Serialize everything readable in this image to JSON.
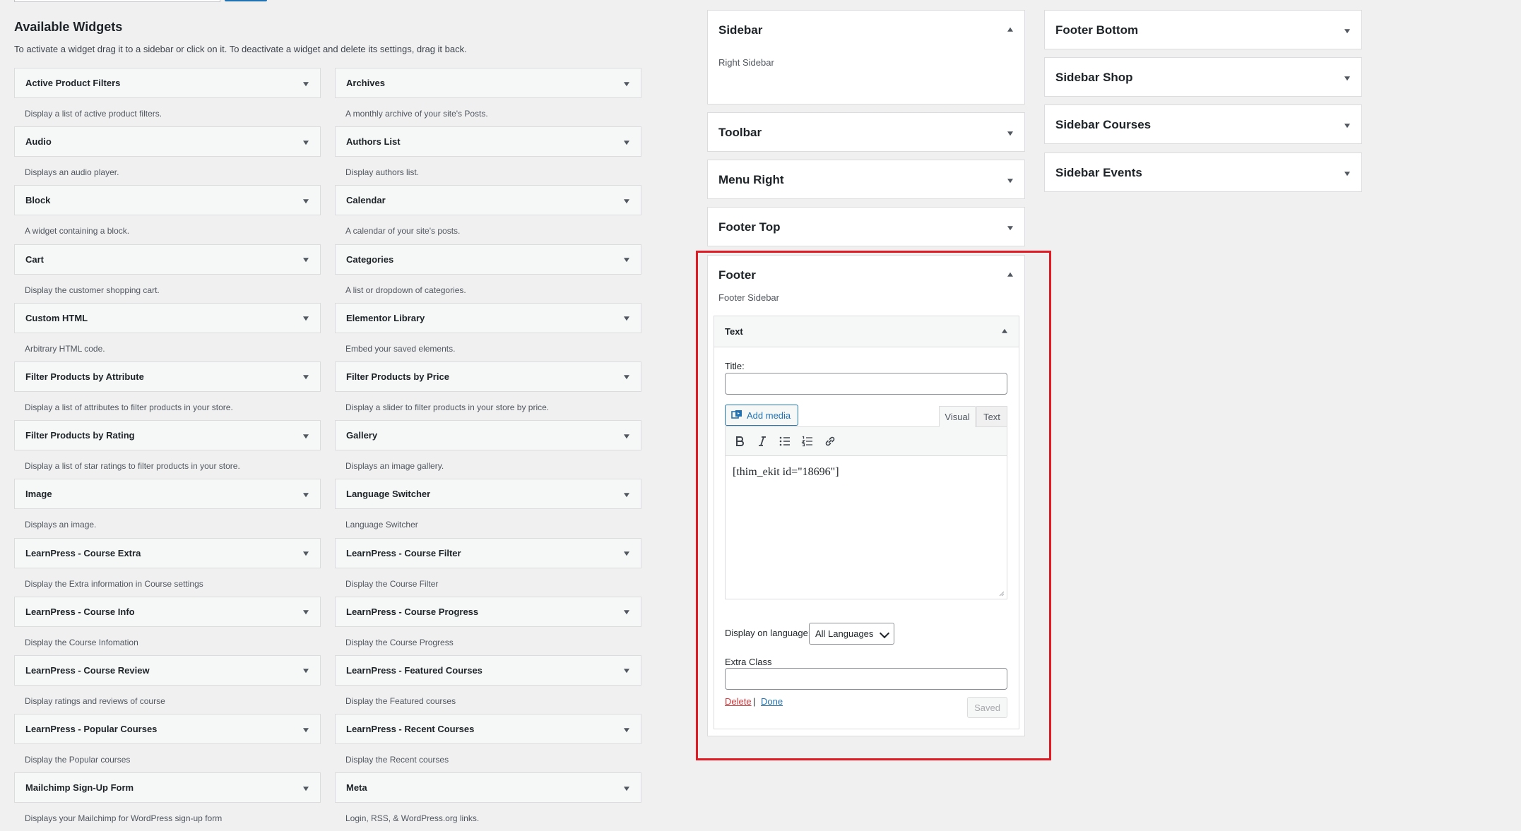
{
  "available_widgets": {
    "title": "Available Widgets",
    "description": "To activate a widget drag it to a sidebar or click on it. To deactivate a widget and delete its settings, drag it back.",
    "items": [
      {
        "name": "Active Product Filters",
        "desc": "Display a list of active product filters."
      },
      {
        "name": "Archives",
        "desc": "A monthly archive of your site's Posts."
      },
      {
        "name": "Audio",
        "desc": "Displays an audio player."
      },
      {
        "name": "Authors List",
        "desc": "Display authors list."
      },
      {
        "name": "Block",
        "desc": "A widget containing a block."
      },
      {
        "name": "Calendar",
        "desc": "A calendar of your site's posts."
      },
      {
        "name": "Cart",
        "desc": "Display the customer shopping cart."
      },
      {
        "name": "Categories",
        "desc": "A list or dropdown of categories."
      },
      {
        "name": "Custom HTML",
        "desc": "Arbitrary HTML code."
      },
      {
        "name": "Elementor Library",
        "desc": "Embed your saved elements."
      },
      {
        "name": "Filter Products by Attribute",
        "desc": "Display a list of attributes to filter products in your store."
      },
      {
        "name": "Filter Products by Price",
        "desc": "Display a slider to filter products in your store by price."
      },
      {
        "name": "Filter Products by Rating",
        "desc": "Display a list of star ratings to filter products in your store."
      },
      {
        "name": "Gallery",
        "desc": "Displays an image gallery."
      },
      {
        "name": "Image",
        "desc": "Displays an image."
      },
      {
        "name": "Language Switcher",
        "desc": "Language Switcher"
      },
      {
        "name": "LearnPress - Course Extra",
        "desc": "Display the Extra information in Course settings"
      },
      {
        "name": "LearnPress - Course Filter",
        "desc": "Display the Course Filter"
      },
      {
        "name": "LearnPress - Course Info",
        "desc": "Display the Course Infomation"
      },
      {
        "name": "LearnPress - Course Progress",
        "desc": "Display the Course Progress"
      },
      {
        "name": "LearnPress - Course Review",
        "desc": "Display ratings and reviews of course"
      },
      {
        "name": "LearnPress - Featured Courses",
        "desc": "Display the Featured courses"
      },
      {
        "name": "LearnPress - Popular Courses",
        "desc": "Display the Popular courses"
      },
      {
        "name": "LearnPress - Recent Courses",
        "desc": "Display the Recent courses"
      },
      {
        "name": "Mailchimp Sign-Up Form",
        "desc": "Displays your Mailchimp for WordPress sign-up form"
      },
      {
        "name": "Meta",
        "desc": "Login, RSS, & WordPress.org links."
      }
    ]
  },
  "sidebars": {
    "sidebar": {
      "title": "Sidebar",
      "desc": "Right Sidebar"
    },
    "toolbar": {
      "title": "Toolbar"
    },
    "menu_right": {
      "title": "Menu Right"
    },
    "footer_top": {
      "title": "Footer Top"
    },
    "footer": {
      "title": "Footer",
      "desc": "Footer Sidebar"
    },
    "footer_bottom": {
      "title": "Footer Bottom"
    },
    "sidebar_shop": {
      "title": "Sidebar Shop"
    },
    "sidebar_courses": {
      "title": "Sidebar Courses"
    },
    "sidebar_events": {
      "title": "Sidebar Events"
    }
  },
  "text_widget": {
    "title": "Text",
    "title_label": "Title:",
    "title_value": "",
    "add_media": "Add media",
    "tab_visual": "Visual",
    "tab_text": "Text",
    "content": "[thim_ekit id=\"18696\"]",
    "display_language_label": "Display on language:",
    "display_language_value": "All Languages",
    "extra_class_label": "Extra Class",
    "extra_class_value": "",
    "delete": "Delete",
    "separator": "|",
    "done": "Done",
    "saved": "Saved"
  },
  "colors": {
    "highlight_frame": "#e01b24",
    "accent": "#2271b1",
    "delete_link": "#d63638"
  }
}
